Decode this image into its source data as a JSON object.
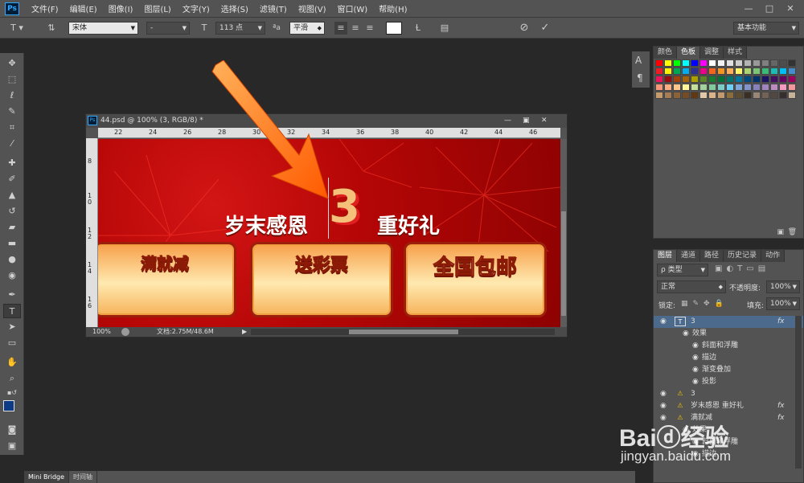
{
  "app": {
    "logo": "Ps"
  },
  "menu": [
    "文件(F)",
    "编辑(E)",
    "图像(I)",
    "图层(L)",
    "文字(Y)",
    "选择(S)",
    "滤镜(T)",
    "视图(V)",
    "窗口(W)",
    "帮助(H)"
  ],
  "window_controls": [
    "—",
    "□",
    "✕"
  ],
  "options": {
    "font_family": "宋体",
    "font_style": "-",
    "font_size": "113 点",
    "aa_label": "a",
    "antialias": "平滑",
    "workspace": "基本功能",
    "color_swatch": "#ffffff"
  },
  "document": {
    "title": "44.psd @ 100% (3, RGB/8) *",
    "ruler_top": [
      "22",
      "24",
      "26",
      "28",
      "30",
      "32",
      "34",
      "36",
      "38",
      "40",
      "42",
      "44",
      "46"
    ],
    "ruler_left": [
      "8",
      "10",
      "12",
      "14",
      "16"
    ],
    "zoom": "100%",
    "doc_info": "文档:2.75M/48.6M",
    "canvas": {
      "headline_left": "岁末感恩",
      "big_number": "3",
      "headline_right": "重好礼",
      "promos": [
        "满就减",
        "送彩票",
        "全国包邮"
      ]
    }
  },
  "swatches_panel": {
    "tabs": [
      "颜色",
      "色板",
      "调整",
      "样式"
    ],
    "active_tab": "色板",
    "colors": [
      "#ff0000",
      "#ffff00",
      "#00ff00",
      "#00ffff",
      "#0000ff",
      "#ff00ff",
      "#ffffff",
      "#f2f2f2",
      "#e0e0e0",
      "#cccccc",
      "#b3b3b3",
      "#999999",
      "#808080",
      "#666666",
      "#4d4d4d",
      "#333333",
      "#ee1c24",
      "#fff200",
      "#00a651",
      "#00aeef",
      "#2e3192",
      "#ec008c",
      "#f26522",
      "#f7941d",
      "#fbaf5d",
      "#fff568",
      "#acd373",
      "#7cc576",
      "#3cb878",
      "#1cbbb4",
      "#00bff3",
      "#448ccb",
      "#ed145b",
      "#9e0b0f",
      "#a0410d",
      "#a36209",
      "#aba000",
      "#598527",
      "#197b30",
      "#007236",
      "#00746b",
      "#0076a3",
      "#004a80",
      "#003471",
      "#1b1464",
      "#440e62",
      "#630460",
      "#9e005d",
      "#f69679",
      "#f9ad81",
      "#fdc68a",
      "#fff79a",
      "#c4df9b",
      "#a3d39c",
      "#82ca9d",
      "#7accc8",
      "#6dcff6",
      "#7da7d9",
      "#8393ca",
      "#8781bd",
      "#a186be",
      "#bd8cbf",
      "#f49ac1",
      "#f5989d",
      "#c69c6d",
      "#a67c52",
      "#8c6239",
      "#754c24",
      "#603913",
      "#e0c9a6",
      "#d9b38c",
      "#c49a6c",
      "#8a6d3b",
      "#5c4d32",
      "#3b2f23",
      "#998675",
      "#736357",
      "#534741",
      "#362f2d",
      "#c7b299"
    ],
    "rows_shown": 8
  },
  "layers_panel": {
    "tabs": [
      "图层",
      "通道",
      "路径",
      "历史记录",
      "动作"
    ],
    "active_tab": "图层",
    "filter_label": "ρ 类型",
    "blend_mode": "正常",
    "opacity_label": "不透明度:",
    "opacity": "100%",
    "lock_label": "锁定:",
    "fill_label": "填充:",
    "fill": "100%",
    "layers": [
      {
        "name": "3",
        "type": "text",
        "fx": "fx",
        "selected": true
      },
      {
        "name": "效果",
        "indent": 1
      },
      {
        "name": "斜面和浮雕",
        "indent": 2
      },
      {
        "name": "描边",
        "indent": 2
      },
      {
        "name": "渐变叠加",
        "indent": 2
      },
      {
        "name": "投影",
        "indent": 2
      },
      {
        "name": "3",
        "type": "warn"
      },
      {
        "name": "岁末感恩    重好礼",
        "type": "warn",
        "fx": "fx"
      },
      {
        "name": "满就减",
        "type": "warn",
        "fx": "fx"
      },
      {
        "name": "效果",
        "indent": 1
      },
      {
        "name": "斜面和浮雕",
        "indent": 2
      },
      {
        "name": "描边",
        "indent": 2
      }
    ]
  },
  "bottom_tabs": [
    "Mini Bridge",
    "时间轴"
  ],
  "watermark": {
    "line1": "Baiⓓ经验",
    "line2": "jingyan.baidu.com"
  }
}
